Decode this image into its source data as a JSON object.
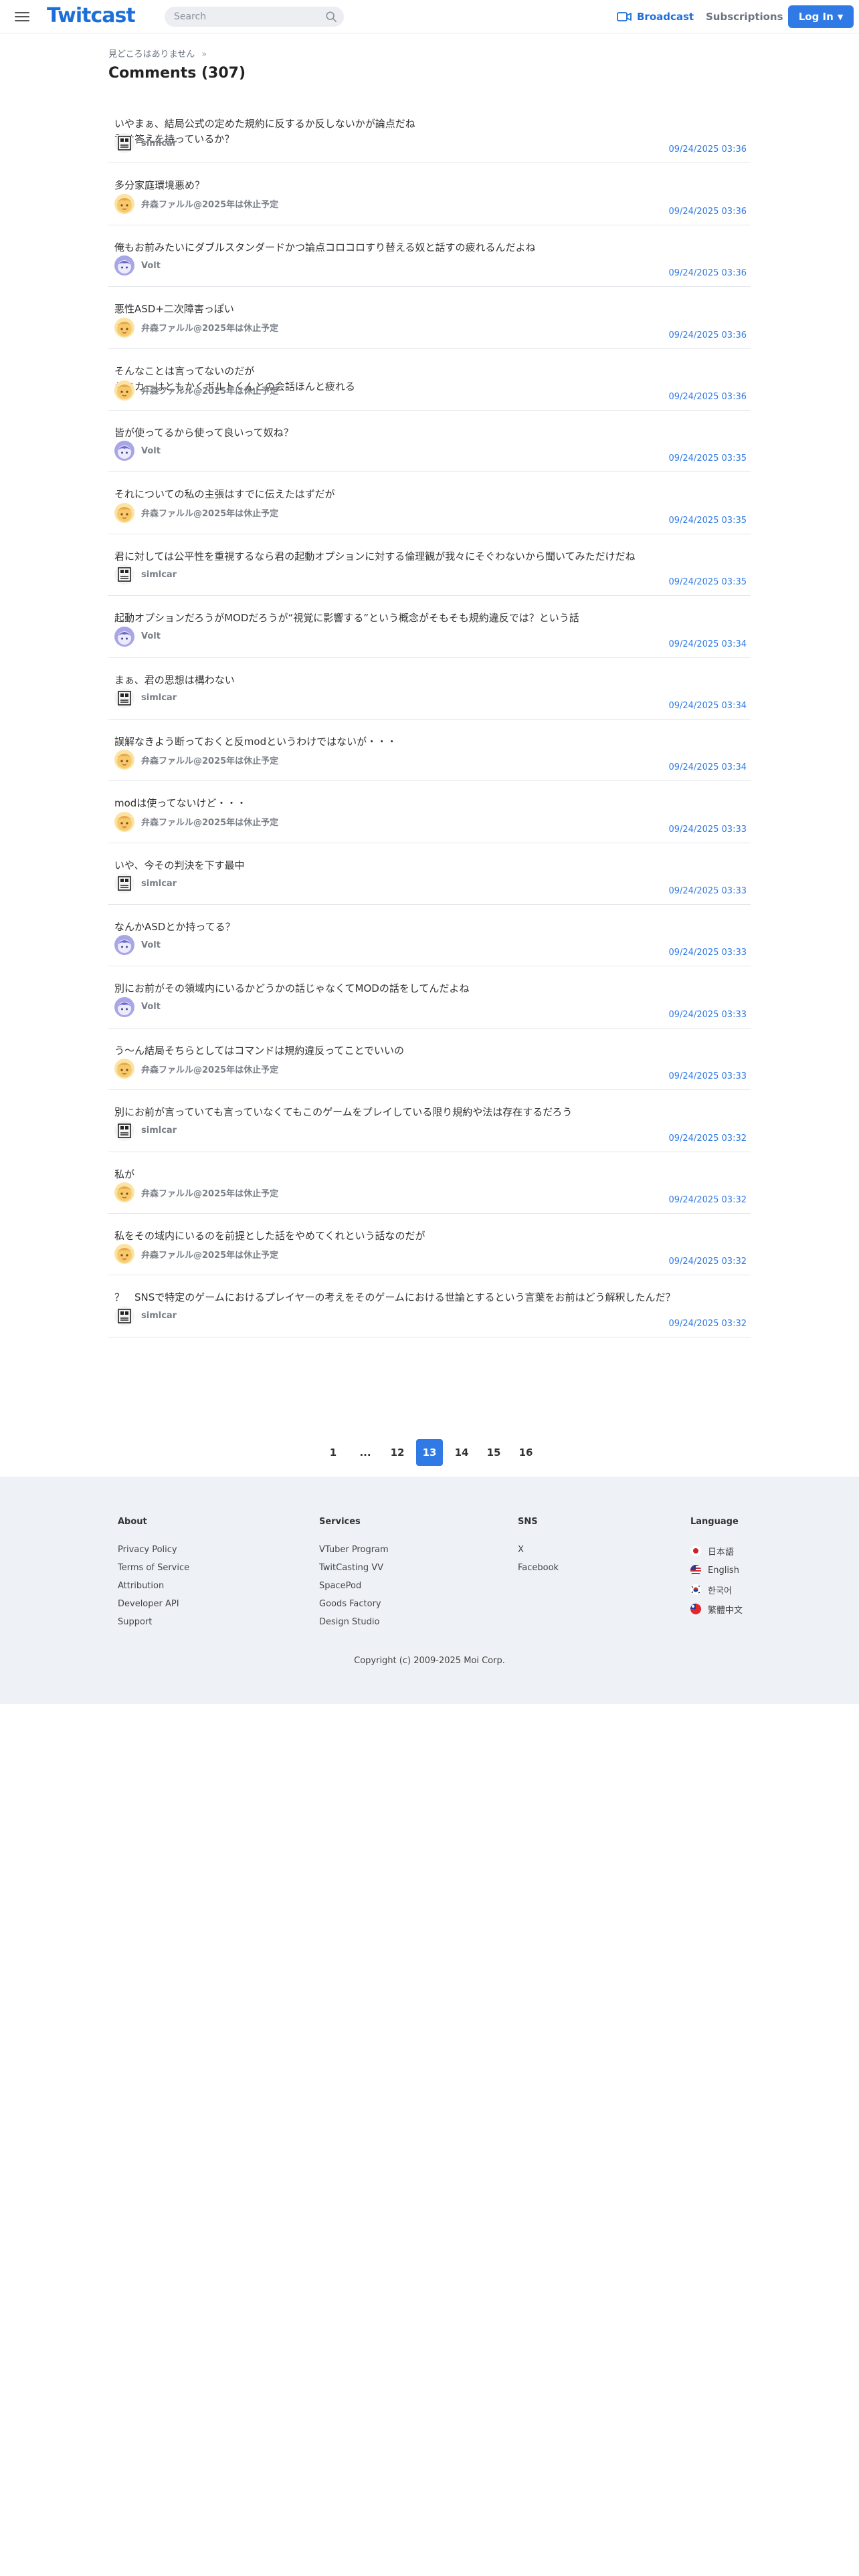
{
  "header": {
    "logo": "Twitcast",
    "search_placeholder": "Search",
    "broadcast": "Broadcast",
    "subscriptions": "Subscriptions",
    "login": "Log In"
  },
  "breadcrumb": "見どころはありません",
  "page_title": "Comments (307)",
  "comments": [
    {
      "text": "いやまぁ、結局公式の定めた規約に反するか反しないかが論点だね\n君は答えを持っているか？",
      "user": "simlcar",
      "avatar": "simlcar",
      "time": "09/24/2025 03:36"
    },
    {
      "text": "多分家庭環境悪め？",
      "user": "弁森ファルル@2025年は休止予定",
      "avatar": "fal",
      "time": "09/24/2025 03:36"
    },
    {
      "text": "俺もお前みたいにダブルスタンダードかつ論点コロコロすり替える奴と話すの疲れるんだよね",
      "user": "Volt",
      "avatar": "volt",
      "time": "09/24/2025 03:36"
    },
    {
      "text": "悪性ASD+二次障害っぽい",
      "user": "弁森ファルル@2025年は休止予定",
      "avatar": "fal",
      "time": "09/24/2025 03:36"
    },
    {
      "text": "そんなことは言ってないのだが\nシミカーはともかくボルトくんとの会話ほんと疲れる",
      "user": "弁森ファルル@2025年は休止予定",
      "avatar": "fal",
      "time": "09/24/2025 03:36"
    },
    {
      "text": "皆が使ってるから使って良いって奴ね？",
      "user": "Volt",
      "avatar": "volt",
      "time": "09/24/2025 03:35"
    },
    {
      "text": "それについての私の主張はすでに伝えたはずだが",
      "user": "弁森ファルル@2025年は休止予定",
      "avatar": "fal",
      "time": "09/24/2025 03:35"
    },
    {
      "text": "君に対しては公平性を重視するなら君の起動オプションに対する倫理観が我々にそぐわないから聞いてみただけだね",
      "user": "simlcar",
      "avatar": "simlcar",
      "time": "09/24/2025 03:35"
    },
    {
      "text": "起動オプションだろうがMODだろうが“視覚に影響する”という概念がそもそも規約違反では？という話",
      "user": "Volt",
      "avatar": "volt",
      "time": "09/24/2025 03:34"
    },
    {
      "text": "まぁ、君の思想は構わない",
      "user": "simlcar",
      "avatar": "simlcar",
      "time": "09/24/2025 03:34"
    },
    {
      "text": "誤解なきよう断っておくと反modというわけではないが・・・",
      "user": "弁森ファルル@2025年は休止予定",
      "avatar": "fal",
      "time": "09/24/2025 03:34"
    },
    {
      "text": "modは使ってないけど・・・",
      "user": "弁森ファルル@2025年は休止予定",
      "avatar": "fal",
      "time": "09/24/2025 03:33"
    },
    {
      "text": "いや、今その判決を下す最中",
      "user": "simlcar",
      "avatar": "simlcar",
      "time": "09/24/2025 03:33"
    },
    {
      "text": "なんかASDとか持ってる？",
      "user": "Volt",
      "avatar": "volt",
      "time": "09/24/2025 03:33"
    },
    {
      "text": "別にお前がその領域内にいるかどうかの話じゃなくてMODの話をしてんだよね",
      "user": "Volt",
      "avatar": "volt",
      "time": "09/24/2025 03:33"
    },
    {
      "text": "う〜ん結局そちらとしてはコマンドは規約違反ってことでいいの",
      "user": "弁森ファルル@2025年は休止予定",
      "avatar": "fal",
      "time": "09/24/2025 03:33"
    },
    {
      "text": "別にお前が言っていても言っていなくてもこのゲームをプレイしている限り規約や法は存在するだろう",
      "user": "simlcar",
      "avatar": "simlcar",
      "time": "09/24/2025 03:32"
    },
    {
      "text": "私が",
      "user": "弁森ファルル@2025年は休止予定",
      "avatar": "fal",
      "time": "09/24/2025 03:32"
    },
    {
      "text": "私をその域内にいるのを前提とした話をやめてくれという話なのだが",
      "user": "弁森ファルル@2025年は休止予定",
      "avatar": "fal",
      "time": "09/24/2025 03:32"
    },
    {
      "text": "？　SNSで特定のゲームにおけるプレイヤーの考えをそのゲームにおける世論とするという言葉をお前はどう解釈したんだ？",
      "user": "simlcar",
      "avatar": "simlcar",
      "time": "09/24/2025 03:32"
    }
  ],
  "pagination": [
    {
      "label": "1",
      "active": false
    },
    {
      "label": "...",
      "active": false
    },
    {
      "label": "12",
      "active": false
    },
    {
      "label": "13",
      "active": true
    },
    {
      "label": "14",
      "active": false
    },
    {
      "label": "15",
      "active": false
    },
    {
      "label": "16",
      "active": false
    }
  ],
  "footer": {
    "about": {
      "title": "About",
      "links": [
        "Privacy Policy",
        "Terms of Service",
        "Attribution",
        "Developer API",
        "Support"
      ]
    },
    "services": {
      "title": "Services",
      "links": [
        "VTuber Program",
        "TwitCasting VV",
        "SpacePod",
        "Goods Factory",
        "Design Studio"
      ]
    },
    "sns": {
      "title": "SNS",
      "links": [
        "X",
        "Facebook"
      ]
    },
    "language": {
      "title": "Language",
      "items": [
        {
          "label": "日本語",
          "flag": "jp"
        },
        {
          "label": "English",
          "flag": "us"
        },
        {
          "label": "한국어",
          "flag": "kr"
        },
        {
          "label": "繁體中文",
          "flag": "tw"
        }
      ]
    },
    "copyright": "Copyright (c) 2009-2025 Moi Corp."
  },
  "colors": {
    "accent": "#2f7ae5",
    "brand": "#1d6fd8",
    "footer_bg": "#eef1f6"
  }
}
